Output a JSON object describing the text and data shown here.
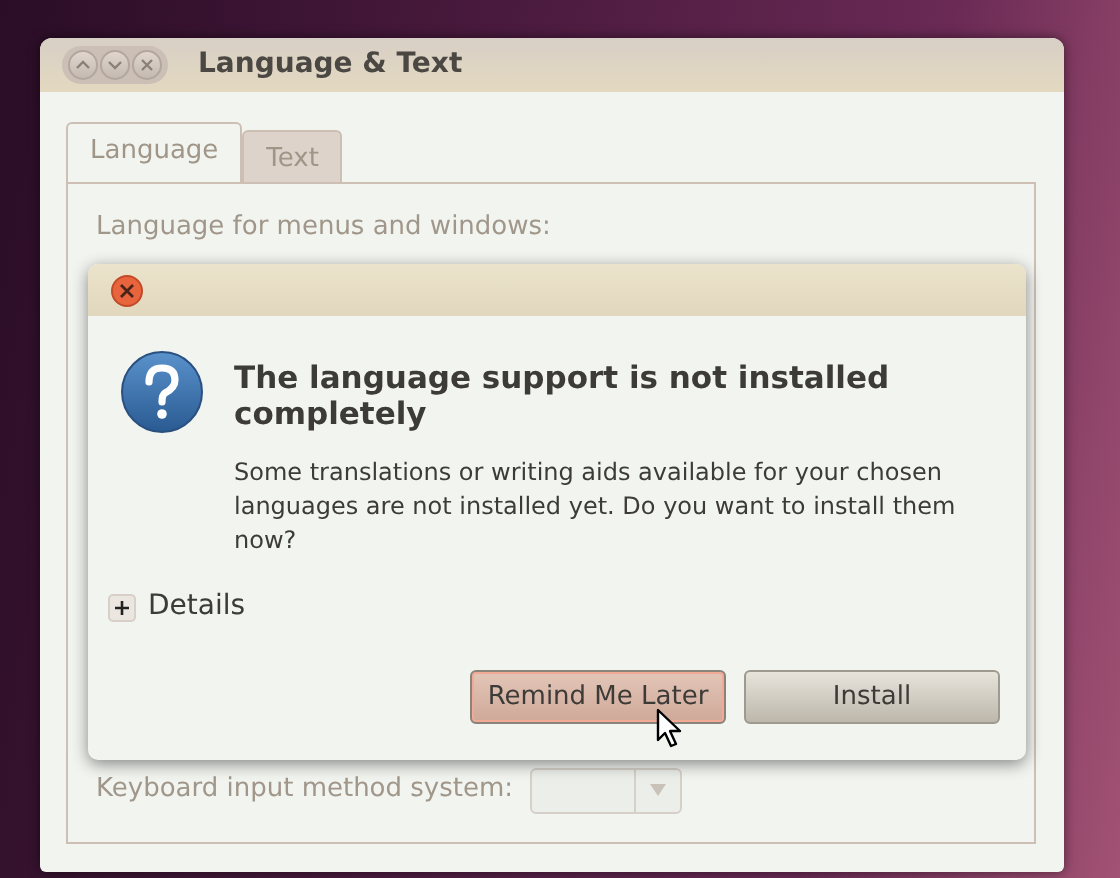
{
  "window": {
    "title": "Language & Text",
    "inactive": true
  },
  "tabs": [
    {
      "label": "Language",
      "selected": true
    },
    {
      "label": "Text",
      "selected": false
    }
  ],
  "language_label": "Language for menus and windows:",
  "keyboard_label": "Keyboard input method system:",
  "dialog": {
    "heading": "The language support is not installed completely",
    "message": "Some translations or writing aids available for your chosen languages are not installed yet. Do you want to install them now?",
    "details": {
      "label": "Details",
      "expanded": false
    },
    "buttons": [
      {
        "label": "Remind Me Later",
        "selected": true
      },
      {
        "label": "Install",
        "selected": false
      }
    ]
  }
}
